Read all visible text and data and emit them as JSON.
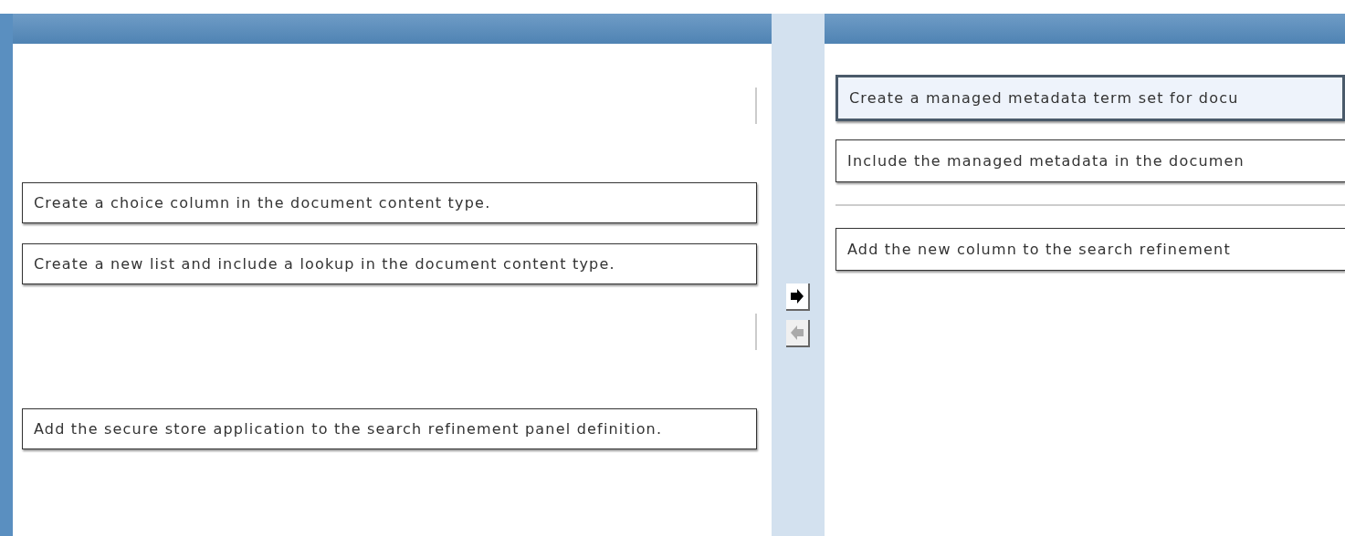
{
  "answer_choices": [
    {
      "kind": "empty"
    },
    {
      "kind": "answer",
      "text": "Create a choice column in the document content type."
    },
    {
      "kind": "answer",
      "text": "Create a new list and include a lookup in the document content type."
    },
    {
      "kind": "empty"
    },
    {
      "kind": "answer",
      "text": "Add the secure store application to the search refinement panel definition."
    }
  ],
  "move_buttons": [
    {
      "kind": "right",
      "disabled": false
    },
    {
      "kind": "left",
      "disabled": true
    }
  ],
  "answer_area": [
    {
      "kind": "answer",
      "text": "Create a managed metadata term set for docu",
      "selected": true
    },
    {
      "kind": "answer",
      "text": "Include the managed metadata in the documen",
      "selected": false
    },
    {
      "kind": "divider"
    },
    {
      "kind": "answer",
      "text": "Add the new column to the search refinement",
      "selected": false
    }
  ]
}
